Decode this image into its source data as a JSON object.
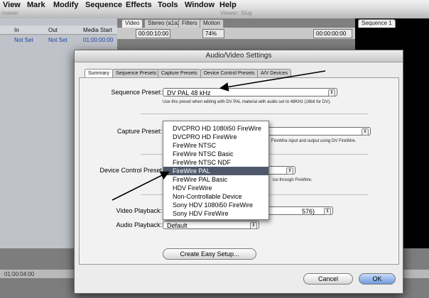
{
  "menubar": [
    "View",
    "Mark",
    "Modify",
    "Sequence",
    "Effects",
    "Tools",
    "Window",
    "Help"
  ],
  "browser": {
    "title": "rowser",
    "columns": [
      "In",
      "Out",
      "Media Start"
    ],
    "row": [
      "Not Set",
      "Not Set",
      "01:00:00:00"
    ]
  },
  "viewer": {
    "title": "Viewer: Slug",
    "tabs": [
      "Video",
      "Stereo (a1a2)",
      "Filters",
      "Motion"
    ],
    "timecode_left": "00:00:10:00",
    "zoom": "74%",
    "timecode_right": "00:00:00:00"
  },
  "canvas": {
    "tab": "Sequence 1"
  },
  "timeline": {
    "timecode": "01:00:04:00"
  },
  "dialog": {
    "title": "Audio/Video Settings",
    "tabs": [
      "Summary",
      "Sequence Presets",
      "Capture Presets",
      "Device Control Presets",
      "A/V Devices"
    ],
    "sequence_preset_label": "Sequence Preset:",
    "sequence_preset_value": "DV PAL 48 kHz",
    "sequence_preset_note": "Use this preset when editing with DV PAL material with audio set to 48KHz (16bit for DV).",
    "capture_preset_label": "Capture Preset:",
    "capture_preset_note": "FireWire input and output using DV FireWire.",
    "device_control_label": "Device Control Preset",
    "device_control_note": "ice through FireWire.",
    "video_playback_label": "Video Playback:",
    "video_playback_value": "576)",
    "audio_playback_label": "Audio Playback:",
    "audio_playback_value": "Default",
    "create_easy_setup": "Create Easy Setup...",
    "cancel": "Cancel",
    "ok": "OK"
  },
  "dropdown": {
    "items": [
      "DVCPRO HD 1080i50 FireWire",
      "DVCPRO HD FireWire",
      "FireWire NTSC",
      "FireWire NTSC Basic",
      "FireWire NTSC NDF",
      "FireWire PAL",
      "FireWire PAL Basic",
      "HDV FireWire",
      "Non-Controllable Device",
      "Sony HDV 1080i50 FireWire",
      "Sony HDV FireWire"
    ],
    "selected": "FireWire PAL"
  }
}
